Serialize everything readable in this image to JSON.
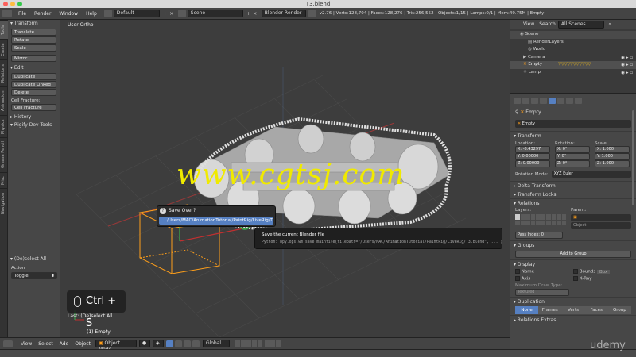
{
  "window": {
    "title": "T3.blend"
  },
  "menubar": {
    "items": [
      "File",
      "Render",
      "Window",
      "Help"
    ],
    "layout": "Default",
    "scene": "Scene",
    "engine": "Blender Render",
    "stats": "v2.76 | Verts:128,704 | Faces:128,276 | Tris:256,552 | Objects:1/15 | Lamps:0/1 | Mem:49.75M | Empty"
  },
  "left_tabs": [
    "Tools",
    "Create",
    "Relations",
    "Animation",
    "Physics",
    "Grease Pencil",
    "Misc",
    "Navigation"
  ],
  "toolshelf": {
    "transform_header": "Transform",
    "transform_buttons": [
      "Translate",
      "Rotate",
      "Scale"
    ],
    "mirror": "Mirror",
    "edit_header": "Edit",
    "edit_buttons": [
      "Duplicate",
      "Duplicate Linked",
      "Delete"
    ],
    "cell_fracture_label": "Cell Fracture:",
    "cell_fracture_button": "Cell Fracture",
    "history_header": "History",
    "rigify_header": "Rigify Dev Tools"
  },
  "operator_panel": {
    "header": "(De)select All",
    "action_label": "Action",
    "action_value": "Toggle"
  },
  "viewport": {
    "view_name": "User Ortho",
    "last_op": "Last: (De)select All",
    "object_label": "(1) Empty"
  },
  "popup": {
    "title": "Save Over?",
    "path": "/Users/MAC/AnimationTutorial/PaintRig/LiveRig/T3.blend"
  },
  "tooltip": {
    "title": "Save the current Blender file",
    "python": "Python: bpy.ops.wm.save_mainfile(filepath=\"/Users/MAC/AnimationTutorial/PaintRig/LiveRig/T3.blend\", ... )"
  },
  "keycast": "Ctrl + S",
  "watermark": "www.cgtsj.com",
  "brand": "udemy",
  "bottombar": {
    "items": [
      "View",
      "Select",
      "Add",
      "Object"
    ],
    "mode": "Object Mode",
    "orientation": "Global"
  },
  "outliner": {
    "view": "View",
    "search": "Search",
    "filter": "All Scenes",
    "rows": [
      "Scene",
      "RenderLayers",
      "World",
      "Camera",
      "Empty",
      "Lamp"
    ]
  },
  "properties": {
    "object_name": "Empty",
    "breadcrumb": "Empty",
    "transform_header": "Transform",
    "location_label": "Location:",
    "rotation_label": "Rotation:",
    "scale_label": "Scale:",
    "location": [
      "X: -8.43297",
      "Y: 0.00000",
      "Z: 0.00000"
    ],
    "rotation": [
      "X: 0°",
      "Y: 0°",
      "Z: 0°"
    ],
    "scale": [
      "X: 1.000",
      "Y: 1.000",
      "Z: 1.000"
    ],
    "rotation_mode_label": "Rotation Mode:",
    "rotation_mode": "XYZ Euler",
    "delta_transform": "Delta Transform",
    "transform_locks": "Transform Locks",
    "relations": "Relations",
    "layers_label": "Layers:",
    "parent_label": "Parent:",
    "parent_type": "Object",
    "pass_index": "Pass Index: 0",
    "groups": "Groups",
    "add_to_group": "Add to Group",
    "display": "Display",
    "name_label": "Name",
    "bounds_label": "Bounds",
    "bounds_value": "Box",
    "axis_label": "Axis",
    "xray_label": "X-Ray",
    "max_draw_label": "Maximum Draw Type:",
    "max_draw_value": "Textured",
    "duplication": "Duplication",
    "dup_tabs": [
      "None",
      "Frames",
      "Verts",
      "Faces",
      "Group"
    ],
    "relations_extras": "Relations Extras"
  },
  "colors": {
    "accent_blue": "#5680c2",
    "selection_orange": "#ff9f1a",
    "watermark_yellow": "#f0ea00"
  }
}
